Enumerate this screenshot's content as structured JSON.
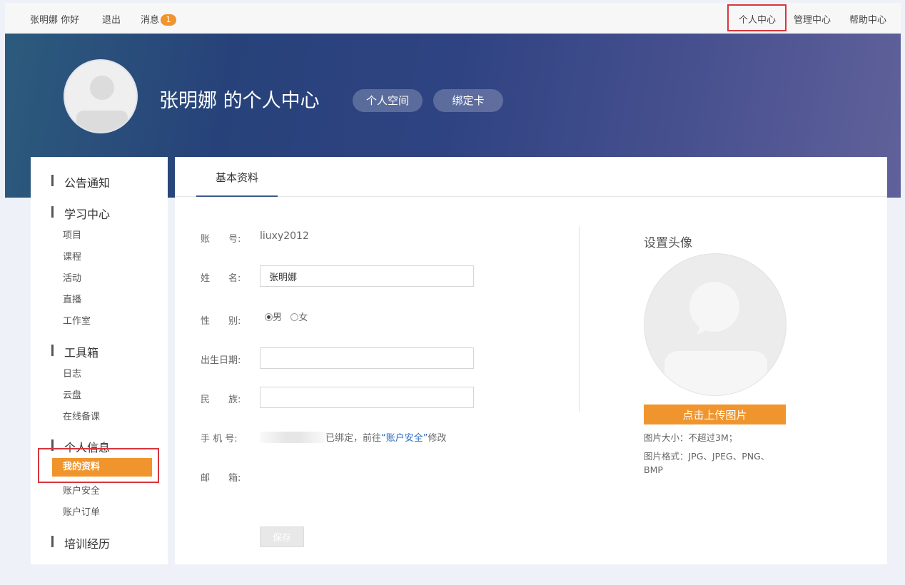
{
  "topbar": {
    "greeting": "张明娜 你好",
    "logout": "退出",
    "messages": "消息",
    "message_count": "1",
    "nav": [
      "个人中心",
      "管理中心",
      "帮助中心"
    ]
  },
  "banner": {
    "title": "张明娜 的个人中心",
    "buttons": [
      "个人空间",
      "绑定卡"
    ]
  },
  "sidebar": {
    "sections": [
      {
        "title": "公告通知",
        "items": []
      },
      {
        "title": "学习中心",
        "items": [
          "项目",
          "课程",
          "活动",
          "直播",
          "工作室"
        ]
      },
      {
        "title": "工具箱",
        "items": [
          "日志",
          "云盘",
          "在线备课"
        ]
      },
      {
        "title": "个人信息",
        "items": [
          "我的资料",
          "账户安全",
          "账户订单"
        ]
      },
      {
        "title": "培训经历",
        "items": []
      }
    ],
    "active_item": "我的资料"
  },
  "main": {
    "tab": "基本资料",
    "form": {
      "account_label": "账　　号:",
      "account_value": "liuxy2012",
      "name_label": "姓　　名:",
      "name_value": "张明娜",
      "gender_label": "性　　别:",
      "gender_male": "男",
      "gender_female": "女",
      "birthday_label": "出生日期:",
      "birthday_value": "",
      "ethnicity_label": "民　　族:",
      "ethnicity_value": "",
      "phone_label": "手 机 号:",
      "phone_bound": "已绑定，前往",
      "phone_link": "“账户安全”",
      "phone_modify": "修改",
      "email_label": "邮　　箱:",
      "save": "保存"
    },
    "avatar": {
      "title": "设置头像",
      "upload": "点击上传图片",
      "size_tip": "图片大小：不超过3M；",
      "format_tip": "图片格式：JPG、JPEG、PNG、BMP"
    }
  },
  "colors": {
    "accent": "#f0952d",
    "highlight": "#d9363e",
    "link": "#2b6cc4"
  }
}
